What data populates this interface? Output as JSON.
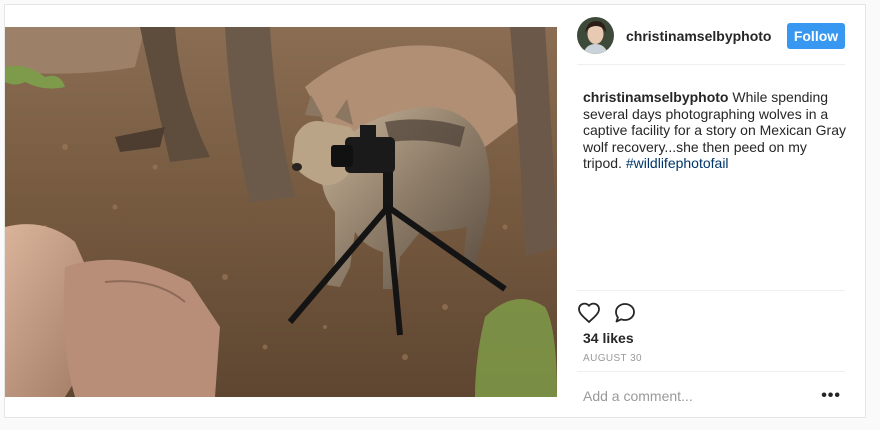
{
  "post": {
    "username": "christinamselbyphoto",
    "follow_label": "Follow",
    "caption_text": " While spending several days photographing wolves in a captive facility for a story on Mexican Gray wolf recovery...she then peed on my tripod. ",
    "hashtag": "#wildlifephotofail",
    "likes": "34 likes",
    "date": "AUGUST 30",
    "comment_placeholder": "Add a comment...",
    "more_label": "•••"
  },
  "icons": {
    "like": "heart-icon",
    "comment": "comment-bubble-icon",
    "more": "more-options-icon"
  },
  "colors": {
    "follow_button": "#3897f0",
    "hashtag": "#003569",
    "muted": "#999999"
  }
}
